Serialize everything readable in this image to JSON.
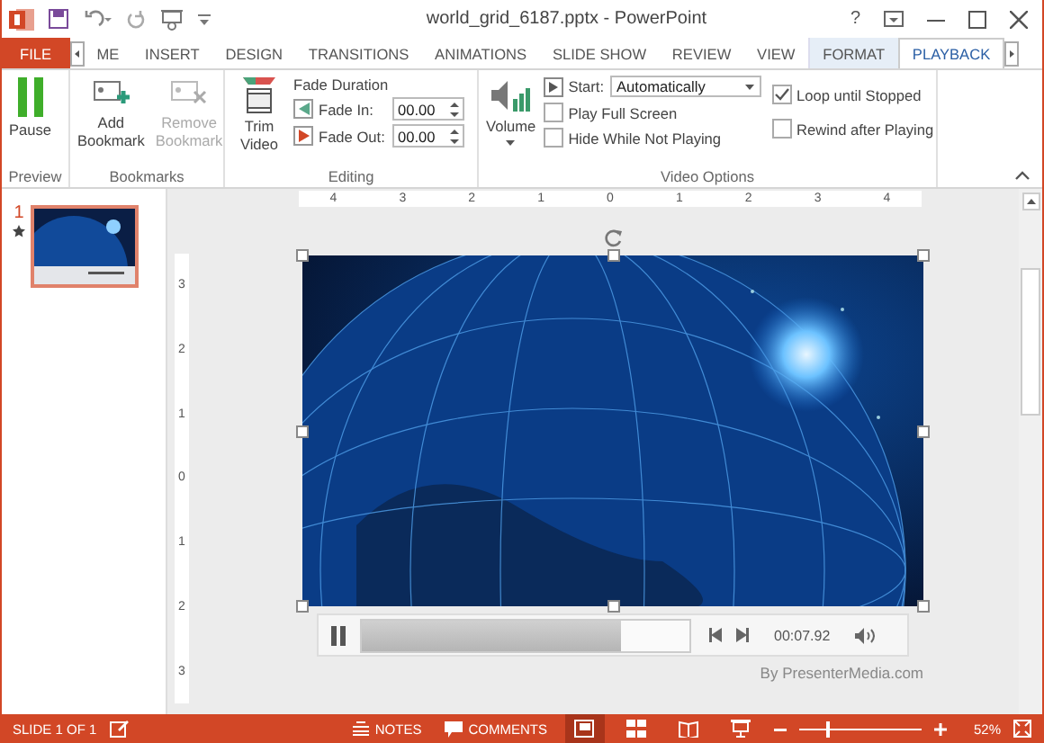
{
  "title_bar": {
    "title": "world_grid_6187.pptx - PowerPoint",
    "help": "?"
  },
  "tabs": [
    {
      "label": "FILE",
      "kind": "file",
      "selected": false
    },
    {
      "label": "ME",
      "kind": "tab",
      "selected": false
    },
    {
      "label": "INSERT",
      "kind": "tab",
      "selected": false
    },
    {
      "label": "DESIGN",
      "kind": "tab",
      "selected": false
    },
    {
      "label": "TRANSITIONS",
      "kind": "tab",
      "selected": false
    },
    {
      "label": "ANIMATIONS",
      "kind": "tab",
      "selected": false
    },
    {
      "label": "SLIDE SHOW",
      "kind": "tab",
      "selected": false
    },
    {
      "label": "REVIEW",
      "kind": "tab",
      "selected": false
    },
    {
      "label": "VIEW",
      "kind": "tab",
      "selected": false
    },
    {
      "label": "FORMAT",
      "kind": "context",
      "selected": false
    },
    {
      "label": "PLAYBACK",
      "kind": "context",
      "selected": true
    }
  ],
  "preview": {
    "label": "Preview",
    "pause": "Pause"
  },
  "bookmarks": {
    "label": "Bookmarks",
    "add": {
      "label": "Add Bookmark",
      "disabled": false
    },
    "remove": {
      "label": "Remove Bookmark",
      "disabled": true
    }
  },
  "editing": {
    "label": "Editing",
    "trim": "Trim Video",
    "fade_title": "Fade Duration",
    "fade_in": {
      "label": "Fade In:",
      "value": "00.00"
    },
    "fade_out": {
      "label": "Fade Out:",
      "value": "00.00"
    }
  },
  "video_options": {
    "label": "Video Options",
    "volume": "Volume",
    "start": {
      "label": "Start:",
      "value": "Automatically"
    },
    "checkboxes": [
      {
        "label": "Play Full Screen",
        "checked": false
      },
      {
        "label": "Hide While Not Playing",
        "checked": false
      },
      {
        "label": "Loop until Stopped",
        "checked": true
      },
      {
        "label": "Rewind after Playing",
        "checked": false
      }
    ]
  },
  "ruler": {
    "horizontal": [
      "4",
      "3",
      "2",
      "1",
      "0",
      "1",
      "2",
      "3",
      "4"
    ],
    "vertical": [
      "3",
      "2",
      "1",
      "0",
      "1",
      "2",
      "3"
    ]
  },
  "slides": [
    {
      "number": "1",
      "selected": true,
      "animated": true
    }
  ],
  "player": {
    "level": 0.79,
    "time": "00:07.92"
  },
  "credit": "By PresenterMedia.com",
  "status_bar": {
    "slide": "SLIDE 1 OF 1",
    "notes": "NOTES",
    "comments": "COMMENTS",
    "zoom": "52%",
    "zoom_slider": {
      "level": 0.24
    },
    "views": [
      {
        "kind": "normal",
        "selected": true
      },
      {
        "kind": "sorter",
        "selected": false
      },
      {
        "kind": "reading",
        "selected": false
      },
      {
        "kind": "slideshow",
        "selected": false
      }
    ]
  }
}
